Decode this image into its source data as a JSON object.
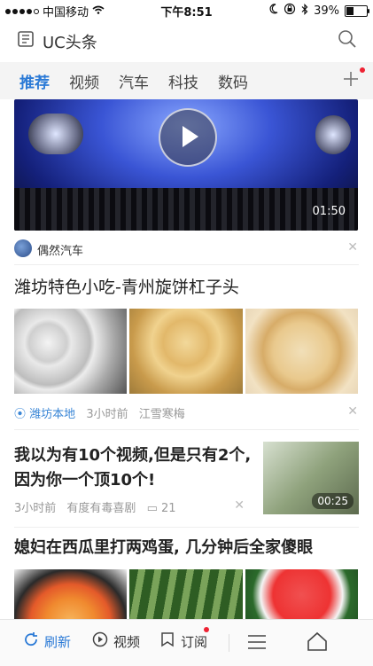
{
  "status": {
    "carrier": "中国移动",
    "time": "下午8:51",
    "battery": "39%"
  },
  "app": {
    "title": "UC头条"
  },
  "tabs": [
    {
      "label": "推荐"
    },
    {
      "label": "视频"
    },
    {
      "label": "汽车"
    },
    {
      "label": "科技"
    },
    {
      "label": "数码"
    }
  ],
  "feed": {
    "video": {
      "duration": "01:50",
      "source": "偶然汽车"
    },
    "article1": {
      "title": "潍坊特色小吃-青州旋饼杠子头",
      "location": "潍坊本地",
      "time": "3小时前",
      "author": "江雪寒梅"
    },
    "article2": {
      "title": "我以为有10个视频,但是只有2个,因为你一个顶10个!",
      "time": "3小时前",
      "author": "有度有毒喜剧",
      "comments": "21",
      "duration": "00:25"
    },
    "article3": {
      "title": "媳妇在西瓜里打两鸡蛋, 几分钟后全家傻眼"
    }
  },
  "bottom": {
    "refresh": "刷新",
    "video": "视频",
    "subscribe": "订阅"
  },
  "colors": {
    "accent": "#2b7ad6",
    "red_dot": "#e23333"
  }
}
